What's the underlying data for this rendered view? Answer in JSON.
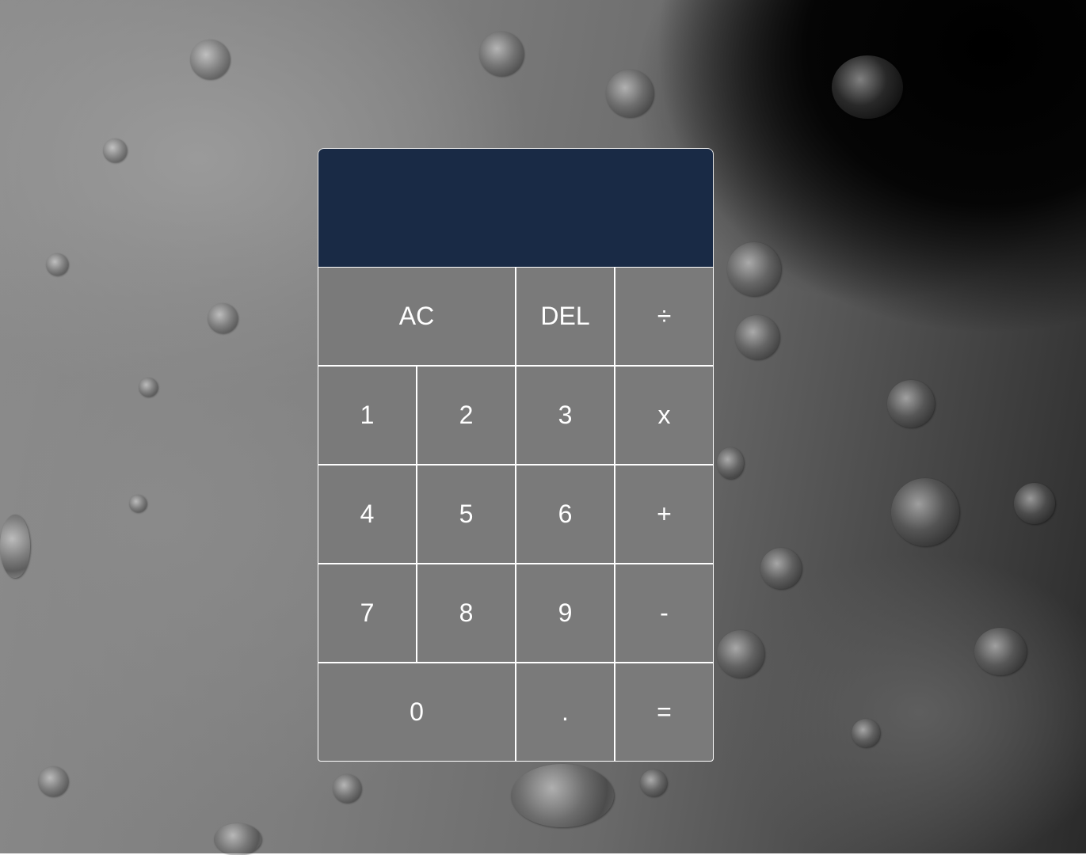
{
  "display": {
    "previous_operand": "",
    "current_operand": ""
  },
  "keys": {
    "ac": "AC",
    "del": "DEL",
    "divide": "÷",
    "one": "1",
    "two": "2",
    "three": "3",
    "multiply": "x",
    "four": "4",
    "five": "5",
    "six": "6",
    "add": "+",
    "seven": "7",
    "eight": "8",
    "nine": "9",
    "subtract": "-",
    "zero": "0",
    "decimal": ".",
    "equals": "="
  },
  "colors": {
    "display_background": "#192a45",
    "key_background": "#7a7a7a",
    "key_border": "#ffffff",
    "key_text": "#ffffff"
  },
  "background": {
    "description_icon": "moon-surface-image"
  }
}
